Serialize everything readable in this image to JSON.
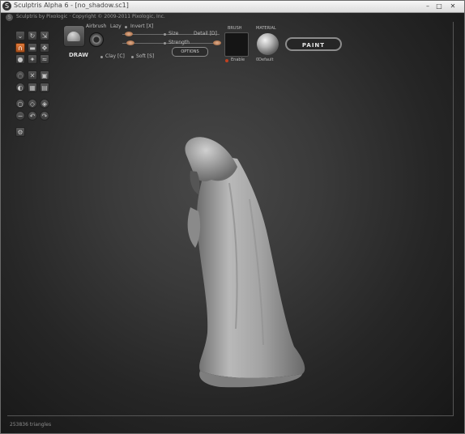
{
  "window": {
    "title": "Sculptris Alpha 6 - [no_shadow.sc1]",
    "controls": {
      "minimize": "–",
      "maximize": "□",
      "close": "✕"
    }
  },
  "info_bar": {
    "text": "Sculptris by Pixologic  ·  Copyright © 2009-2011 Pixologic, Inc."
  },
  "toolbar": {
    "brush_mode": "DRAW",
    "airbrush_label": "Airbrush",
    "lazy_label": "Lazy",
    "invert_label": "Invert [X]",
    "size_label": "Size",
    "strength_label": "Strength",
    "detail_label": "Detail [D]",
    "clay_label": "Clay [C]",
    "soft_label": "Soft [S]",
    "options_label": "OPTIONS",
    "brush_label": "BRUSH",
    "enable_label": "Enable",
    "material_label": "MATERIAL",
    "material_name": "0Default",
    "paint_label": "PAINT"
  },
  "tools": [
    {
      "name": "crease-tool",
      "glyph": "⌄"
    },
    {
      "name": "rotate-tool",
      "glyph": "↻"
    },
    {
      "name": "scale-tool",
      "glyph": "⇲"
    },
    {
      "name": "draw-tool",
      "glyph": "∩"
    },
    {
      "name": "flatten-tool",
      "glyph": "▬"
    },
    {
      "name": "grab-tool",
      "glyph": "✥"
    },
    {
      "name": "inflate-tool",
      "glyph": "●"
    },
    {
      "name": "pinch-tool",
      "glyph": "✦"
    },
    {
      "name": "smooth-tool",
      "glyph": "≈"
    },
    {
      "name": "reduce-brush-tool",
      "glyph": "◌"
    },
    {
      "name": "mask-tool",
      "glyph": "✕"
    },
    {
      "name": "reduce-selected-tool",
      "glyph": "▣"
    },
    {
      "name": "symmetry-tool",
      "glyph": "◐"
    },
    {
      "name": "wireframe-tool",
      "glyph": "▦"
    },
    {
      "name": "grid-tool",
      "glyph": "▤"
    },
    {
      "name": "new-sphere-tool",
      "glyph": "○"
    },
    {
      "name": "new-plane-tool",
      "glyph": "◇"
    },
    {
      "name": "subdivide-tool",
      "glyph": "◈"
    },
    {
      "name": "reduce-tool",
      "glyph": "−"
    },
    {
      "name": "undo-tool",
      "glyph": "↶"
    },
    {
      "name": "redo-tool",
      "glyph": "↷"
    },
    {
      "name": "settings-tool",
      "glyph": "⚙"
    }
  ],
  "status": {
    "triangles": "253836 triangles"
  },
  "colors": {
    "accent_active_tool": "#d06a2c",
    "viewport_center": "#484848",
    "viewport_edge": "#151515",
    "model": "#a9a9a9"
  }
}
